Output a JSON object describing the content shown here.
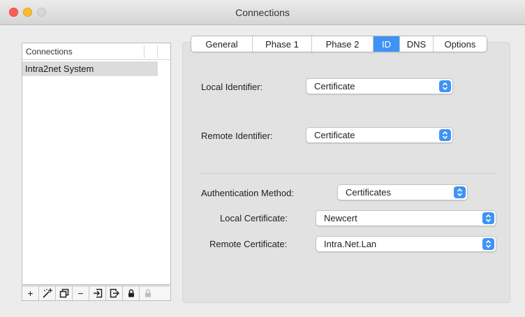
{
  "window": {
    "title": "Connections"
  },
  "sidebar": {
    "header": "Connections",
    "items": [
      {
        "label": "Intra2net System",
        "selected": true
      }
    ],
    "toolbar": [
      {
        "icon": "plus-icon",
        "label": "+"
      },
      {
        "icon": "magic-wand-icon"
      },
      {
        "icon": "duplicate-icon"
      },
      {
        "icon": "minus-icon",
        "label": "−"
      },
      {
        "icon": "import-icon"
      },
      {
        "icon": "export-icon"
      },
      {
        "icon": "lock-icon"
      },
      {
        "icon": "unlock-icon",
        "disabled": true
      }
    ]
  },
  "tabs": [
    {
      "label": "General"
    },
    {
      "label": "Phase 1"
    },
    {
      "label": "Phase 2"
    },
    {
      "label": "ID",
      "active": true
    },
    {
      "label": "DNS"
    },
    {
      "label": "Options"
    }
  ],
  "form": {
    "local_identifier": {
      "label": "Local Identifier:",
      "value": "Certificate"
    },
    "remote_identifier": {
      "label": "Remote Identifier:",
      "value": "Certificate"
    },
    "auth_method": {
      "label": "Authentication Method:",
      "value": "Certificates"
    },
    "local_certificate": {
      "label": "Local Certificate:",
      "value": "Newcert"
    },
    "remote_certificate": {
      "label": "Remote Certificate:",
      "value": "Intra.Net.Lan"
    }
  },
  "colors": {
    "accent": "#3d94f6",
    "close": "#fd5f57",
    "minimize": "#fdbc2e"
  }
}
